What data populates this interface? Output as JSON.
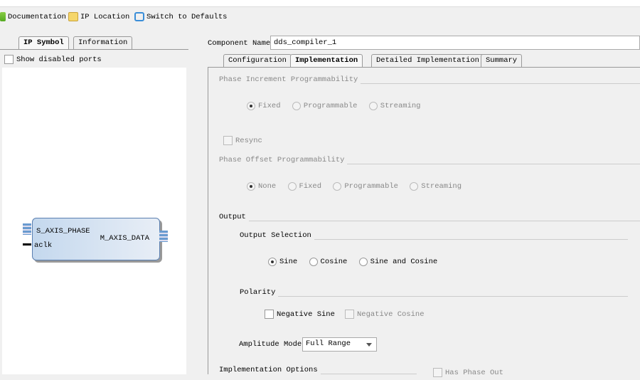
{
  "toolbar": {
    "documentation": "Documentation",
    "ip_location": "IP Location",
    "switch_defaults": "Switch to Defaults"
  },
  "left": {
    "tabs": [
      "IP Symbol",
      "Information"
    ],
    "show_disabled": "Show disabled ports",
    "symbol": {
      "ports_left": [
        "S_AXIS_PHASE",
        "aclk"
      ],
      "ports_right": [
        "M_AXIS_DATA"
      ]
    }
  },
  "component": {
    "label": "Component Name",
    "value": "dds_compiler_1"
  },
  "tabs": [
    "Configuration",
    "Implementation",
    "Detailed Implementation",
    "Summary"
  ],
  "impl": {
    "phase_inc": {
      "title": "Phase Increment Programmability",
      "options": [
        "Fixed",
        "Programmable",
        "Streaming"
      ],
      "selected": "Fixed"
    },
    "resync": "Resync",
    "phase_off": {
      "title": "Phase Offset Programmability",
      "options": [
        "None",
        "Fixed",
        "Programmable",
        "Streaming"
      ],
      "selected": "None"
    },
    "output": "Output",
    "output_sel": {
      "title": "Output Selection",
      "options": [
        "Sine",
        "Cosine",
        "Sine and Cosine"
      ],
      "selected": "Sine"
    },
    "polarity": {
      "title": "Polarity",
      "negative_sine": "Negative Sine",
      "negative_cosine": "Negative Cosine"
    },
    "amplitude": {
      "label": "Amplitude Mode",
      "value": "Full Range"
    },
    "impl_options": "Implementation Options",
    "has_phase_out": "Has Phase Out"
  }
}
